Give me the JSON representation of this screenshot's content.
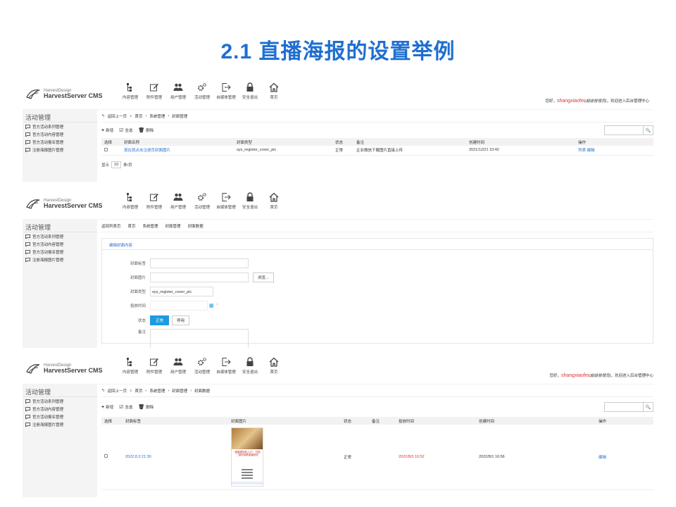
{
  "slide_title": "2.1 直播海报的设置举例",
  "app": {
    "logo_sub": "HarvestDesign",
    "logo_main": "HarvestServer CMS",
    "nav": [
      {
        "label": "内容管理",
        "icon": "content-tree-icon"
      },
      {
        "label": "附件管理",
        "icon": "edit-icon"
      },
      {
        "label": "用户管理",
        "icon": "users-icon"
      },
      {
        "label": "活动管理",
        "icon": "gears-icon"
      },
      {
        "label": "自媒体管理",
        "icon": "export-icon"
      },
      {
        "label": "安全退出",
        "icon": "lock-icon"
      },
      {
        "label": "首页",
        "icon": "home-icon"
      }
    ],
    "welcome_prefix": "您好，",
    "username": "shangxiaofei",
    "role": "(超级管理员)",
    "welcome_suffix": "，欢迎进入后台管理中心",
    "sidebar_title": "活动管理",
    "sidebar_items": [
      "官方活动系列管理",
      "官方活动内容管理",
      "官方活动报名管理",
      "注册海报图片管理"
    ]
  },
  "panel1": {
    "breadcrumb": [
      "返回上一页",
      "首页",
      "›",
      "系统管理",
      "›",
      "封面管理"
    ],
    "toolbar": {
      "add": "新增",
      "select_all": "全选",
      "delete": "删除"
    },
    "columns": [
      "选择",
      "封面名称",
      "封面类型",
      "状态",
      "备注",
      "创建时间",
      "操作"
    ],
    "rows": [
      {
        "name": "现在就点击注册页封面图片",
        "type": "sys_register_cover_pic",
        "status": "正常",
        "note": "企业微信下载图片直接上传",
        "created": "2021/12/21 10:42",
        "ops": "列表 编辑"
      }
    ],
    "pager": {
      "show": "显示",
      "size": "10",
      "unit": "条/页"
    }
  },
  "panel2": {
    "tabs": [
      "返回列表页",
      "首页",
      "系统管理",
      "封面管理",
      "封面数据"
    ],
    "form_tab": "编辑封面内容",
    "fields": {
      "label_title": "封面标签",
      "label_image": "封面图片",
      "browse": "浏览...",
      "label_type": "封面类型",
      "type_value": "sys_register_cover_pic",
      "label_time": "投放时间",
      "label_status": "状态",
      "status_on": "正常",
      "status_off": "停用",
      "label_note": "备注"
    }
  },
  "panel3": {
    "breadcrumb": [
      "返回上一页",
      "首页",
      "›",
      "系统管理",
      "›",
      "封面管理",
      "›",
      "封面数据"
    ],
    "toolbar": {
      "add": "新增",
      "select_all": "全选",
      "delete": "删除"
    },
    "columns": [
      "选择",
      "封面标签",
      "封面图片",
      "状态",
      "备注",
      "投放时间",
      "创建时间",
      "操作"
    ],
    "rows": [
      {
        "label": "2022.8.3 21:30",
        "status": "正常",
        "release": "2022/8/3 10:52",
        "created": "2022/8/1 16:56",
        "ops": "编辑"
      }
    ],
    "poster_text": "“直播课回放入口”，扫描二维码观看直播回放"
  }
}
